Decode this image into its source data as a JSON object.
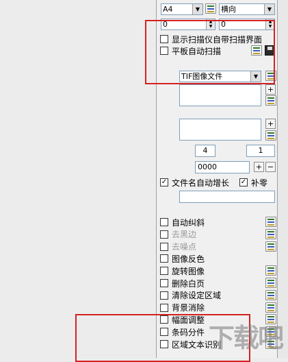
{
  "page_size": {
    "value": "A4"
  },
  "orientation": {
    "value": "横向"
  },
  "offset_x": {
    "value": "0"
  },
  "offset_y": {
    "value": "0"
  },
  "show_scanner_ui": {
    "label": "显示扫描仪自带扫描界面",
    "checked": false
  },
  "flatbed_auto_scan": {
    "label": "平板自动扫描",
    "checked": false
  },
  "file_format": {
    "value": "TIF图像文件"
  },
  "num_a": {
    "value": "4"
  },
  "num_b": {
    "value": "1"
  },
  "counter": {
    "value": "0000"
  },
  "auto_increment": {
    "label": "文件名自动增长",
    "checked": true
  },
  "zero_pad": {
    "label": "补零",
    "checked": true
  },
  "options": [
    {
      "label": "自动纠斜",
      "checked": false,
      "enabled": true,
      "has_config": true
    },
    {
      "label": "去黑边",
      "checked": false,
      "enabled": false,
      "has_config": true
    },
    {
      "label": "去噪点",
      "checked": false,
      "enabled": false,
      "has_config": true
    },
    {
      "label": "图像反色",
      "checked": false,
      "enabled": true,
      "has_config": false
    },
    {
      "label": "旋转图像",
      "checked": false,
      "enabled": true,
      "has_config": true
    },
    {
      "label": "删除白页",
      "checked": false,
      "enabled": true,
      "has_config": true
    },
    {
      "label": "清除设定区域",
      "checked": false,
      "enabled": true,
      "has_config": true
    },
    {
      "label": "背景消除",
      "checked": false,
      "enabled": true,
      "has_config": true
    },
    {
      "label": "幅面调整",
      "checked": false,
      "enabled": true,
      "has_config": true
    },
    {
      "label": "条码分件",
      "checked": false,
      "enabled": true,
      "has_config": true
    },
    {
      "label": "区域文本识别",
      "checked": false,
      "enabled": true,
      "has_config": true
    }
  ],
  "buttons": {
    "plus": "+",
    "minus": "−",
    "spin_up": "▲",
    "spin_down": "▼",
    "dropdown": "▼"
  },
  "checkmark": "✓",
  "icons": [
    "settings-list-icon",
    "save-disk-icon",
    "dropdown-arrow-icon"
  ],
  "colors": {
    "highlight": "#d42020",
    "panel": "#f0f0f0",
    "field_border": "#7f9db9"
  }
}
